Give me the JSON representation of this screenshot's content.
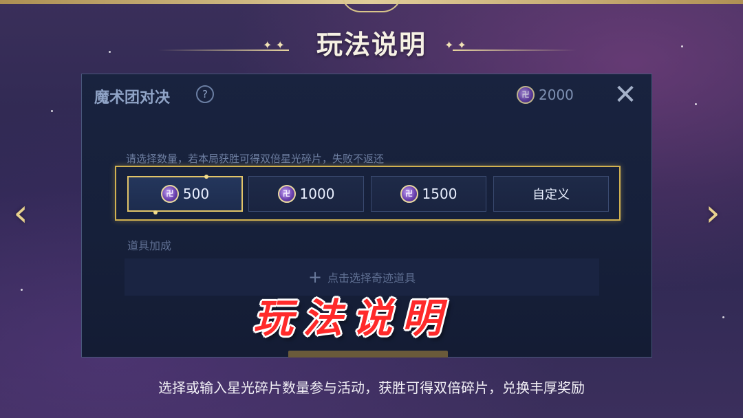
{
  "header": {
    "title": "玩法说明"
  },
  "panel": {
    "title": "魔术团对决",
    "help_icon": "question-diamond-icon",
    "currency_icon": "star-fragment-coin-icon",
    "currency_amount": "2000",
    "close_icon": "close-icon",
    "hint": "请选择数量，若本局获胜可得双倍星光碎片，失败不返还",
    "options": [
      {
        "label": "500",
        "selected": true,
        "icon": "star-fragment-coin-icon"
      },
      {
        "label": "1000",
        "selected": false,
        "icon": "star-fragment-coin-icon"
      },
      {
        "label": "1500",
        "selected": false,
        "icon": "star-fragment-coin-icon"
      },
      {
        "label": "自定义",
        "selected": false
      }
    ],
    "boost_label": "道具加成",
    "boost_button": "点击选择奇迹道具"
  },
  "overlay_title": "玩法说明",
  "caption": "选择或输入星光碎片数量参与活动，获胜可得双倍碎片，兑换丰厚奖励",
  "nav": {
    "prev_icon": "chevron-left-icon",
    "next_icon": "chevron-right-icon"
  },
  "colors": {
    "gold_accent": "#d2b251",
    "overlay_red": "#ff2a2a",
    "panel_bg": "#19233f"
  }
}
